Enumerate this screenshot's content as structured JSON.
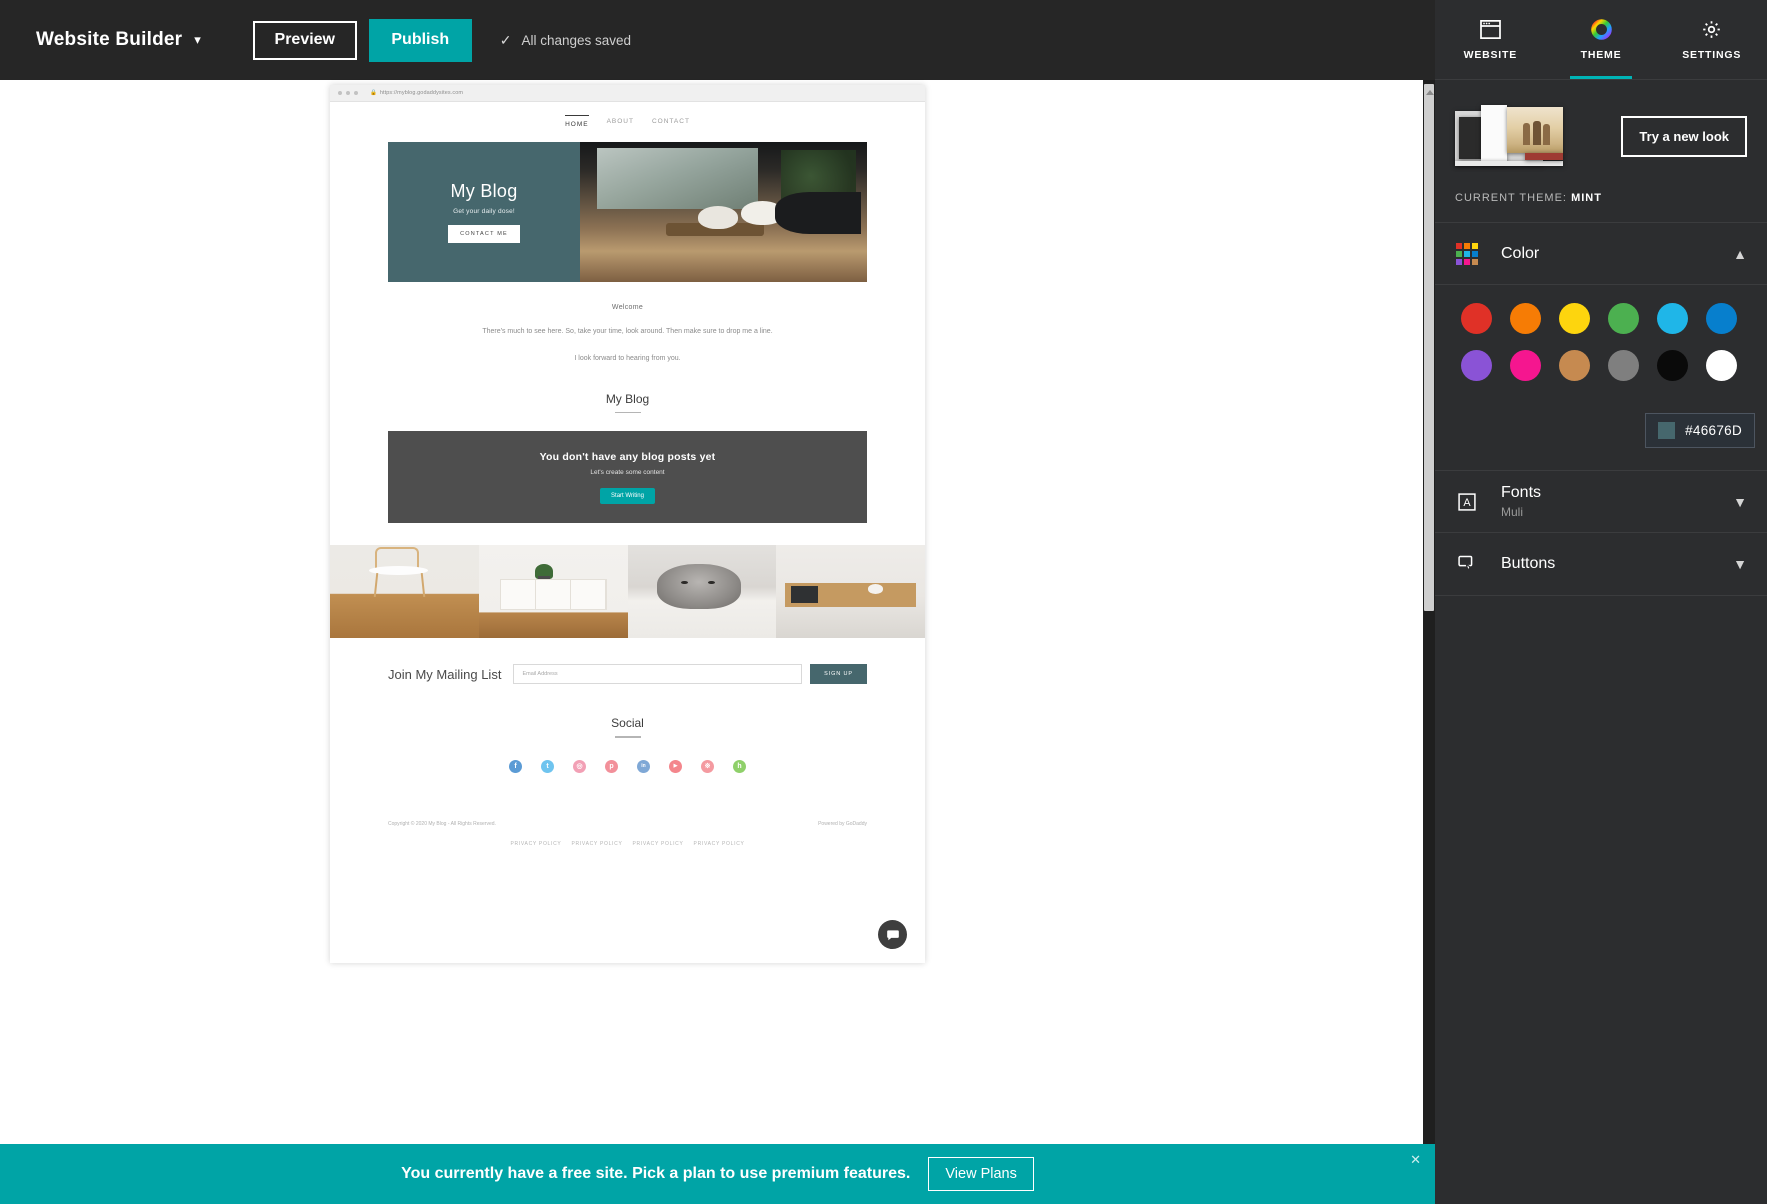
{
  "topbar": {
    "app_title": "Website Builder",
    "caret_icon": "chevron-down-icon",
    "preview_label": "Preview",
    "publish_label": "Publish",
    "saved_check": "✓",
    "saved_label": "All changes saved",
    "publish_color": "#00a4a6"
  },
  "preview": {
    "browser": {
      "url": "https://myblog.godaddysites.com",
      "lock_icon": "lock-icon"
    },
    "nav": [
      {
        "label": "HOME",
        "active": true
      },
      {
        "label": "ABOUT",
        "active": false
      },
      {
        "label": "CONTACT",
        "active": false
      }
    ],
    "hero": {
      "title": "My Blog",
      "subtitle": "Get your daily dose!",
      "button": "CONTACT ME",
      "bg_color": "#46676D"
    },
    "welcome": {
      "heading": "Welcome",
      "paragraph": "There's much to see here. So, take your time, look around. Then make sure to drop me a line.",
      "paragraph2": "I look forward to hearing from you."
    },
    "blog": {
      "section_title": "My Blog",
      "empty_title": "You don't have any blog posts yet",
      "empty_subtitle": "Let's create some content",
      "empty_button": "Start Writing"
    },
    "mailing": {
      "label": "Join My Mailing List",
      "placeholder": "Email Address",
      "value": "",
      "button": "SIGN UP"
    },
    "social": {
      "title": "Social",
      "icons": [
        {
          "name": "facebook-icon",
          "glyph": "f",
          "color": "#5b9bd5"
        },
        {
          "name": "twitter-icon",
          "glyph": "t",
          "color": "#6fc4ef"
        },
        {
          "name": "instagram-icon",
          "glyph": "◎",
          "color": "#f2a0b5"
        },
        {
          "name": "pinterest-icon",
          "glyph": "p",
          "color": "#f2909a"
        },
        {
          "name": "linkedin-icon",
          "glyph": "in",
          "color": "#7fa8d6"
        },
        {
          "name": "youtube-icon",
          "glyph": "▶",
          "color": "#f4868c"
        },
        {
          "name": "yelp-icon",
          "glyph": "※",
          "color": "#f49aa0"
        },
        {
          "name": "houzz-icon",
          "glyph": "h",
          "color": "#8fd06a"
        }
      ]
    },
    "footer": {
      "copyright": "Copyright © 2020 My Blog - All Rights Reserved.",
      "powered": "Powered by GoDaddy",
      "privacy_links": [
        "PRIVACY POLICY",
        "PRIVACY POLICY",
        "PRIVACY POLICY",
        "PRIVACY POLICY"
      ]
    },
    "chat_icon": "chat-bubble-icon"
  },
  "panel": {
    "tabs": [
      {
        "label": "WEBSITE",
        "icon": "browser-window-icon",
        "active": false
      },
      {
        "label": "THEME",
        "icon": "color-wheel-icon",
        "active": true
      },
      {
        "label": "SETTINGS",
        "icon": "gear-icon",
        "active": false
      }
    ],
    "try_new_look": "Try a new look",
    "current_theme_label": "CURRENT THEME:",
    "current_theme_name": "MINT",
    "color": {
      "title": "Color",
      "icon": "color-grid-icon",
      "chevron": "chevron-up-icon",
      "swatches_row1": [
        "#e03127",
        "#f67c05",
        "#fdd50e",
        "#4cb050",
        "#1fb6e8",
        "#077fcd"
      ],
      "swatches_row2": [
        "#8a53d6",
        "#f5168f",
        "#c68a50",
        "#7f7f7f",
        "#0a0a0a",
        "#ffffff"
      ],
      "selected_hex": "#46676D"
    },
    "fonts": {
      "title": "Fonts",
      "value": "Muli",
      "icon": "font-a-icon",
      "chevron": "chevron-down-icon"
    },
    "buttons": {
      "title": "Buttons",
      "icon": "button-cursor-icon",
      "chevron": "chevron-down-icon"
    }
  },
  "banner": {
    "text": "You currently have a free site. Pick a plan to use premium features.",
    "button": "View Plans",
    "close_icon": "close-icon",
    "bg_color": "#00a4a6"
  }
}
